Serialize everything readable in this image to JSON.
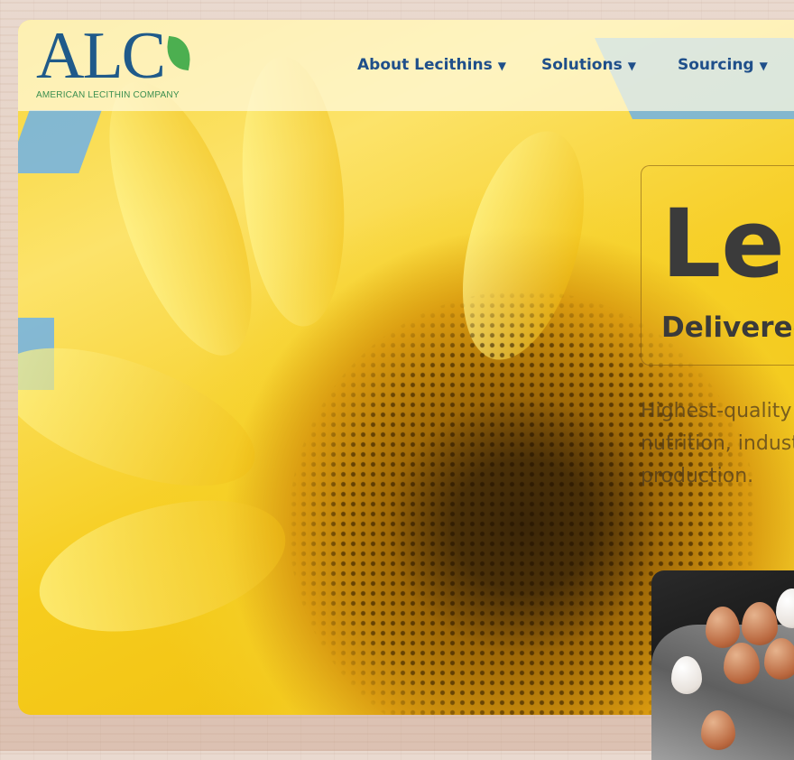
{
  "logo": {
    "letters": "ALC",
    "tagline": "AMERICAN LECITHIN COMPANY"
  },
  "nav": {
    "items": [
      {
        "label": "About Lecithins"
      },
      {
        "label": "Solutions"
      },
      {
        "label": "Sourcing"
      }
    ],
    "chevron": "⌄"
  },
  "hero": {
    "title": "Le",
    "subtitle": "Delivered",
    "description_lines": [
      "Highest-quality l",
      "nutrition, indust",
      "production."
    ]
  },
  "icons": {
    "chevron": "chevron-down-icon",
    "leaf": "leaf-icon"
  },
  "colors": {
    "brand_blue": "#1f5a8a",
    "brand_green": "#4caf50",
    "nav_text": "#1f4f8a"
  }
}
